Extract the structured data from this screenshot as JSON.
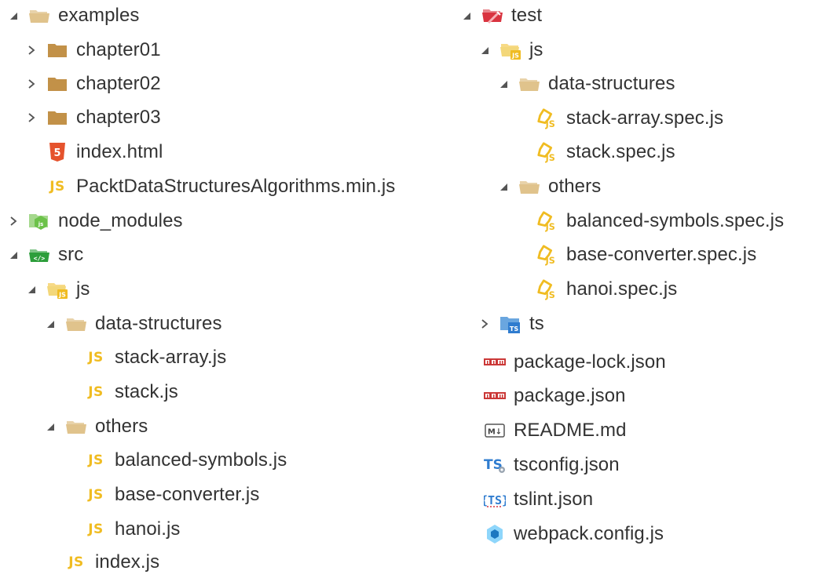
{
  "colors": {
    "folder": "#e0c38c",
    "folder_closed": "#c29148",
    "js_yellow": "#f0bc22",
    "html_orange": "#e5532d",
    "node_green": "#6cc24a",
    "src_green": "#2d9e3b",
    "test_red": "#d9333f",
    "ts_blue": "#2f7ccf",
    "npm_red": "#cb3837",
    "webpack_blue": "#8ed6fb",
    "text": "#333333"
  },
  "left_tree": [
    {
      "label": "examples",
      "twisty": "expanded",
      "icon": "folder-open-icon"
    },
    {
      "label": "chapter01",
      "twisty": "collapsed",
      "icon": "folder-closed-icon"
    },
    {
      "label": "chapter02",
      "twisty": "collapsed",
      "icon": "folder-closed-icon"
    },
    {
      "label": "chapter03",
      "twisty": "collapsed",
      "icon": "folder-closed-icon"
    },
    {
      "label": "index.html",
      "twisty": "none",
      "icon": "html5-icon"
    },
    {
      "label": "PacktDataStructuresAlgorithms.min.js",
      "twisty": "none",
      "icon": "js-icon"
    },
    {
      "label": "node_modules",
      "twisty": "collapsed",
      "icon": "node-folder-icon"
    },
    {
      "label": "src",
      "twisty": "expanded",
      "icon": "src-folder-icon"
    },
    {
      "label": "js",
      "twisty": "expanded",
      "icon": "js-folder-icon"
    },
    {
      "label": "data-structures",
      "twisty": "expanded",
      "icon": "folder-open-icon"
    },
    {
      "label": "stack-array.js",
      "twisty": "none",
      "icon": "js-icon"
    },
    {
      "label": "stack.js",
      "twisty": "none",
      "icon": "js-icon"
    },
    {
      "label": "others",
      "twisty": "expanded",
      "icon": "folder-open-icon"
    },
    {
      "label": "balanced-symbols.js",
      "twisty": "none",
      "icon": "js-icon"
    },
    {
      "label": "base-converter.js",
      "twisty": "none",
      "icon": "js-icon"
    },
    {
      "label": "hanoi.js",
      "twisty": "none",
      "icon": "js-icon"
    },
    {
      "label": "index.js",
      "twisty": "none",
      "icon": "js-icon"
    }
  ],
  "right_tree": [
    {
      "label": "test",
      "twisty": "expanded",
      "icon": "test-folder-icon"
    },
    {
      "label": "js",
      "twisty": "expanded",
      "icon": "js-folder-icon"
    },
    {
      "label": "data-structures",
      "twisty": "expanded",
      "icon": "folder-open-icon"
    },
    {
      "label": "stack-array.spec.js",
      "twisty": "none",
      "icon": "js-spec-icon"
    },
    {
      "label": "stack.spec.js",
      "twisty": "none",
      "icon": "js-spec-icon"
    },
    {
      "label": "others",
      "twisty": "expanded",
      "icon": "folder-open-icon"
    },
    {
      "label": "balanced-symbols.spec.js",
      "twisty": "none",
      "icon": "js-spec-icon"
    },
    {
      "label": "base-converter.spec.js",
      "twisty": "none",
      "icon": "js-spec-icon"
    },
    {
      "label": "hanoi.spec.js",
      "twisty": "none",
      "icon": "js-spec-icon"
    },
    {
      "label": "ts",
      "twisty": "collapsed",
      "icon": "ts-folder-icon"
    },
    {
      "label": "package-lock.json",
      "twisty": "none",
      "icon": "npm-icon"
    },
    {
      "label": "package.json",
      "twisty": "none",
      "icon": "npm-icon"
    },
    {
      "label": "README.md",
      "twisty": "none",
      "icon": "markdown-icon"
    },
    {
      "label": "tsconfig.json",
      "twisty": "none",
      "icon": "tsconfig-icon"
    },
    {
      "label": "tslint.json",
      "twisty": "none",
      "icon": "tslint-icon"
    },
    {
      "label": "webpack.config.js",
      "twisty": "none",
      "icon": "webpack-icon"
    }
  ]
}
